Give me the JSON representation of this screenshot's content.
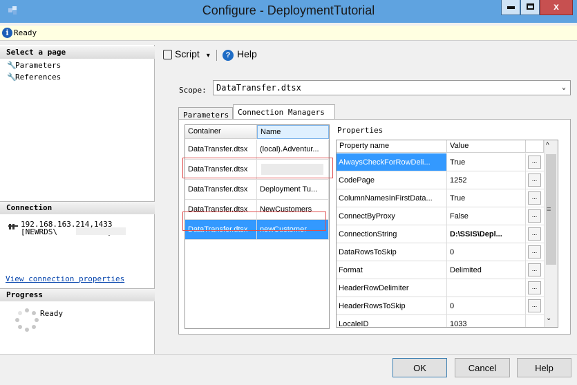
{
  "window": {
    "title": "Configure - DeploymentTutorial",
    "min_label": "–",
    "max_label": "□",
    "close_label": "x"
  },
  "status": {
    "icon": "i",
    "text": "Ready"
  },
  "left": {
    "select_page_header": "Select a page",
    "pages": [
      "Parameters",
      "References"
    ],
    "connection_header": "Connection",
    "connection_server": "192.168.163.214,1433",
    "connection_user": "[NEWRDS\\",
    "connection_user_end": "]",
    "view_connection": "View connection properties",
    "progress_header": "Progress",
    "progress_text": "Ready"
  },
  "toolbar": {
    "script_label": "Script",
    "script_arrow": "▾",
    "help_label": "Help"
  },
  "scope": {
    "label": "Scope:",
    "value": "DataTransfer.dtsx",
    "arrow": "⌄"
  },
  "tabs": {
    "parameters": "Parameters",
    "connection_managers": "Connection Managers"
  },
  "conn_grid": {
    "headers": {
      "container": "Container",
      "name": "Name"
    },
    "rows": [
      {
        "container": "DataTransfer.dtsx",
        "name": "(local).Adventur..."
      },
      {
        "container": "DataTransfer.dtsx",
        "name": ""
      },
      {
        "container": "DataTransfer.dtsx",
        "name": "Deployment Tu..."
      },
      {
        "container": "DataTransfer.dtsx",
        "name": "NewCustomers"
      },
      {
        "container": "DataTransfer.dtsx",
        "name": "newCustomer"
      }
    ]
  },
  "properties": {
    "label": "Properties",
    "headers": {
      "name": "Property name",
      "value": "Value"
    },
    "ellipsis": "...",
    "rows": [
      {
        "name": "AlwaysCheckForRowDeli...",
        "value": "True"
      },
      {
        "name": "CodePage",
        "value": "1252"
      },
      {
        "name": "ColumnNamesInFirstData...",
        "value": "True"
      },
      {
        "name": "ConnectByProxy",
        "value": "False"
      },
      {
        "name": "ConnectionString",
        "value": "D:\\SSIS\\Depl..."
      },
      {
        "name": "DataRowsToSkip",
        "value": "0"
      },
      {
        "name": "Format",
        "value": "Delimited"
      },
      {
        "name": "HeaderRowDelimiter",
        "value": ""
      },
      {
        "name": "HeaderRowsToSkip",
        "value": "0"
      },
      {
        "name": "LocaleID",
        "value": "1033"
      }
    ]
  },
  "buttons": {
    "ok": "OK",
    "cancel": "Cancel",
    "help": "Help"
  },
  "scrollbar": {
    "up": "^",
    "down": "⌄",
    "grip": "≡"
  }
}
